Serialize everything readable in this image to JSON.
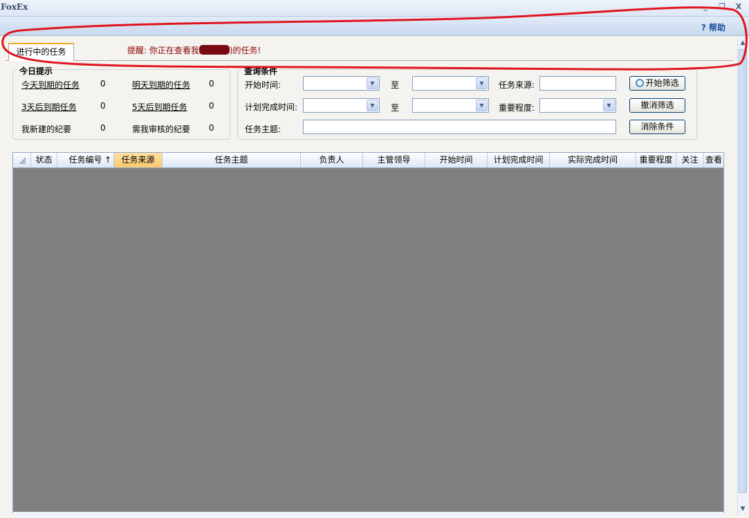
{
  "window": {
    "title": "FoxEx",
    "minimize": "_",
    "maximize": "❐",
    "close": "X"
  },
  "toolbar": {
    "help_icon": "?",
    "help_label": "帮助"
  },
  "tabs": [
    {
      "label": "进行中的任务",
      "active": true
    }
  ],
  "reminder": {
    "prefix": "提醒: 你正在查看我",
    "suffix": ")的任务!"
  },
  "today": {
    "title": "今日提示",
    "items": [
      {
        "label": "今天到期的任务",
        "count": "0",
        "link": true
      },
      {
        "label": "明天到期的任务",
        "count": "0",
        "link": true
      },
      {
        "label": "3天后到期任务",
        "count": "0",
        "link": true
      },
      {
        "label": "5天后到期任务",
        "count": "0",
        "link": true
      },
      {
        "label": "我新建的纪要",
        "count": "0",
        "link": false
      },
      {
        "label": "需我审核的纪要",
        "count": "0",
        "link": false
      }
    ]
  },
  "query": {
    "title": "查询条件",
    "start_time_label": "开始时间:",
    "plan_finish_label": "计划完成时间:",
    "to_label": "至",
    "source_label": "任务来源:",
    "importance_label": "重要程度:",
    "subject_label": "任务主题:",
    "start_time_from": "",
    "start_time_to": "",
    "plan_finish_from": "",
    "plan_finish_to": "",
    "source_value": "",
    "importance_value": "",
    "subject_value": "",
    "btn_filter": "开始筛选",
    "btn_cancel": "撤消筛选",
    "btn_clear": "消除条件"
  },
  "grid": {
    "columns": [
      "状态",
      "任务编号",
      "任务来源",
      "任务主题",
      "负责人",
      "主管领导",
      "开始时间",
      "计划完成时间",
      "实际完成时间",
      "重要程度",
      "关注",
      "查看"
    ],
    "sort_indicator": "↑"
  },
  "colors": {
    "accent": "#f5a623",
    "reminder": "#8b0000",
    "grid_bg": "#808080",
    "annotation": "#e0141e"
  }
}
